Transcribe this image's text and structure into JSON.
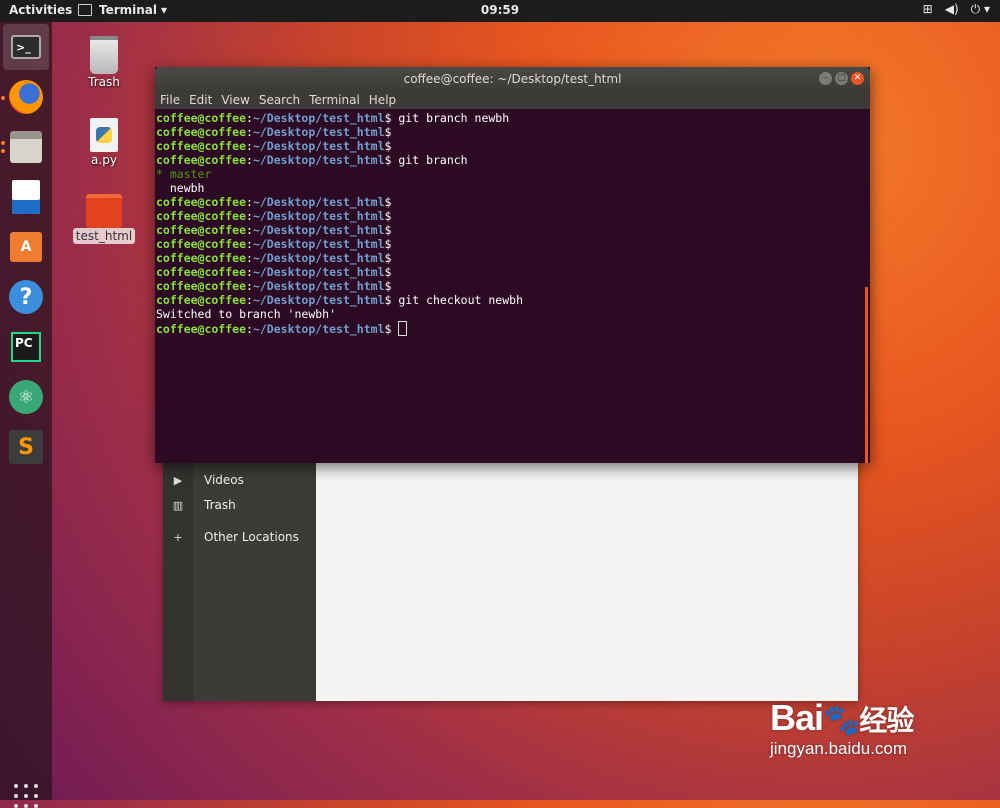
{
  "topbar": {
    "activities": "Activities",
    "app_name": "Terminal",
    "clock": "09:59"
  },
  "dock": {
    "items": [
      {
        "name": "terminal",
        "label": ">_"
      },
      {
        "name": "firefox"
      },
      {
        "name": "files"
      },
      {
        "name": "writer"
      },
      {
        "name": "software",
        "label": "A"
      },
      {
        "name": "help",
        "label": "?"
      },
      {
        "name": "pycharm",
        "label": "PC"
      },
      {
        "name": "atom"
      },
      {
        "name": "sublime",
        "label": "S"
      }
    ]
  },
  "desktop": {
    "icons": [
      {
        "label": "Trash"
      },
      {
        "label": "a.py"
      },
      {
        "label": "test_html"
      }
    ]
  },
  "terminal": {
    "title": "coffee@coffee: ~/Desktop/test_html",
    "menu": [
      "File",
      "Edit",
      "View",
      "Search",
      "Terminal",
      "Help"
    ],
    "prompt_user": "coffee@coffee",
    "prompt_path": "~/Desktop/test_html",
    "lines": [
      {
        "type": "prompt",
        "cmd": "git branch newbh"
      },
      {
        "type": "prompt",
        "cmd": ""
      },
      {
        "type": "prompt",
        "cmd": ""
      },
      {
        "type": "prompt",
        "cmd": "git branch"
      },
      {
        "type": "current_branch",
        "text": "* master"
      },
      {
        "type": "output",
        "text": "  newbh"
      },
      {
        "type": "prompt",
        "cmd": ""
      },
      {
        "type": "prompt",
        "cmd": ""
      },
      {
        "type": "prompt",
        "cmd": ""
      },
      {
        "type": "prompt",
        "cmd": ""
      },
      {
        "type": "prompt",
        "cmd": ""
      },
      {
        "type": "prompt",
        "cmd": ""
      },
      {
        "type": "prompt",
        "cmd": ""
      },
      {
        "type": "prompt",
        "cmd": "git checkout newbh"
      },
      {
        "type": "output",
        "text": "Switched to branch 'newbh'"
      },
      {
        "type": "prompt_cursor",
        "cmd": ""
      }
    ]
  },
  "files": {
    "sidebar": [
      {
        "icon": "video-icon",
        "label": "Videos"
      },
      {
        "icon": "trash-icon",
        "label": "Trash"
      },
      {
        "icon": "plus-icon",
        "label": "Other Locations"
      }
    ]
  },
  "watermark": {
    "brand": "Bai",
    "brand_cn": "经验",
    "url": "jingyan.baidu.com"
  }
}
